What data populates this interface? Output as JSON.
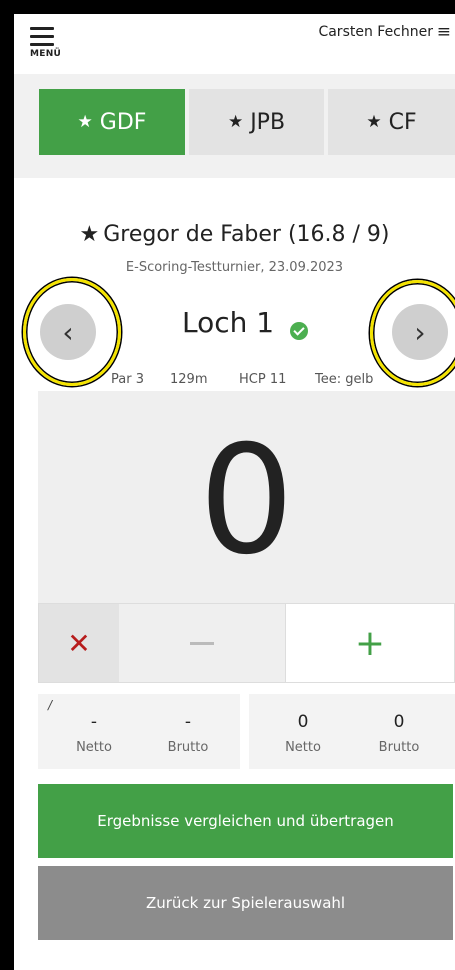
{
  "header": {
    "menu_label": "MENÜ",
    "user_name": "Carsten Fechner",
    "user_menu_icon": "≡"
  },
  "tabs": [
    {
      "label": "GDF",
      "icon": "star",
      "active": true
    },
    {
      "label": "JPB",
      "icon": "star",
      "active": false
    },
    {
      "label": "CF",
      "icon": "star",
      "active": false
    }
  ],
  "player": {
    "name": "Gregor de Faber (16.8 / 9)",
    "tournament": "E-Scoring-Testturnier, 23.09.2023"
  },
  "hole": {
    "title": "Loch 1",
    "par": "Par 3",
    "length": "129m",
    "hcp": "HCP 11",
    "tee": "Tee: gelb",
    "prev_icon": "‹",
    "next_icon": "›"
  },
  "score": {
    "value": "0",
    "clear_icon": "✕",
    "plus_icon": "+"
  },
  "results": {
    "left": {
      "slash": "/",
      "netto_value": "-",
      "brutto_value": "-",
      "netto_label": "Netto",
      "brutto_label": "Brutto"
    },
    "right": {
      "netto_value": "0",
      "brutto_value": "0",
      "netto_label": "Netto",
      "brutto_label": "Brutto"
    }
  },
  "buttons": {
    "compare": "Ergebnisse vergleichen und übertragen",
    "back": "Zurück zur Spielerauswahl"
  },
  "colors": {
    "accent_green": "#43a047",
    "clear_red": "#b71c1c",
    "highlight_ring": "#f4e300"
  }
}
